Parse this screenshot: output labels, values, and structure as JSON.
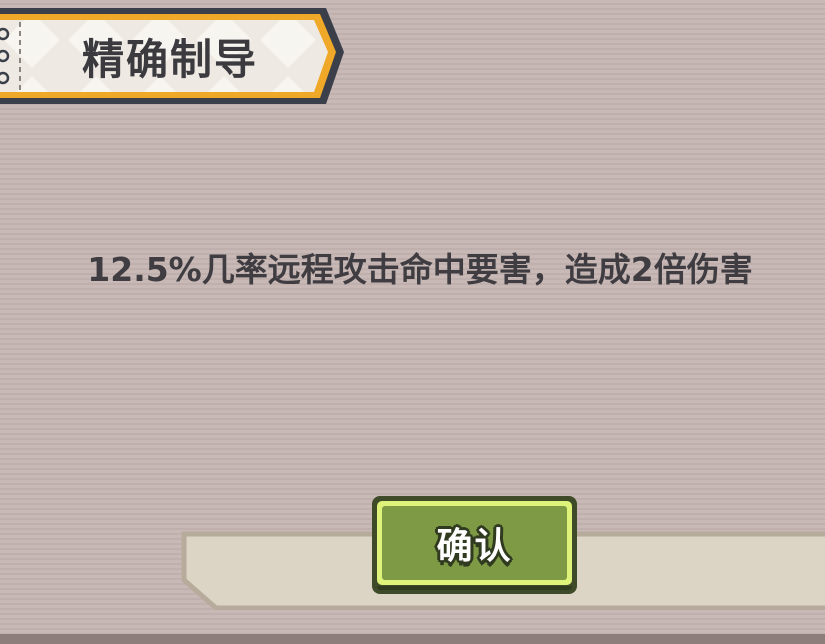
{
  "skill": {
    "title": "精确制导",
    "description": "12.5%几率远程攻击命中要害，造成2倍伤害"
  },
  "actions": {
    "confirm_label": "确认"
  },
  "colors": {
    "background": "#c6b7b4",
    "ribbon_fill": "#eeeae3",
    "ribbon_border": "#f0a828",
    "ribbon_outline": "#3a3f4a",
    "text": "#3f3d42",
    "button_face": "#7f9a45",
    "button_highlight": "#dff27a",
    "button_outline": "#3f4a28"
  }
}
